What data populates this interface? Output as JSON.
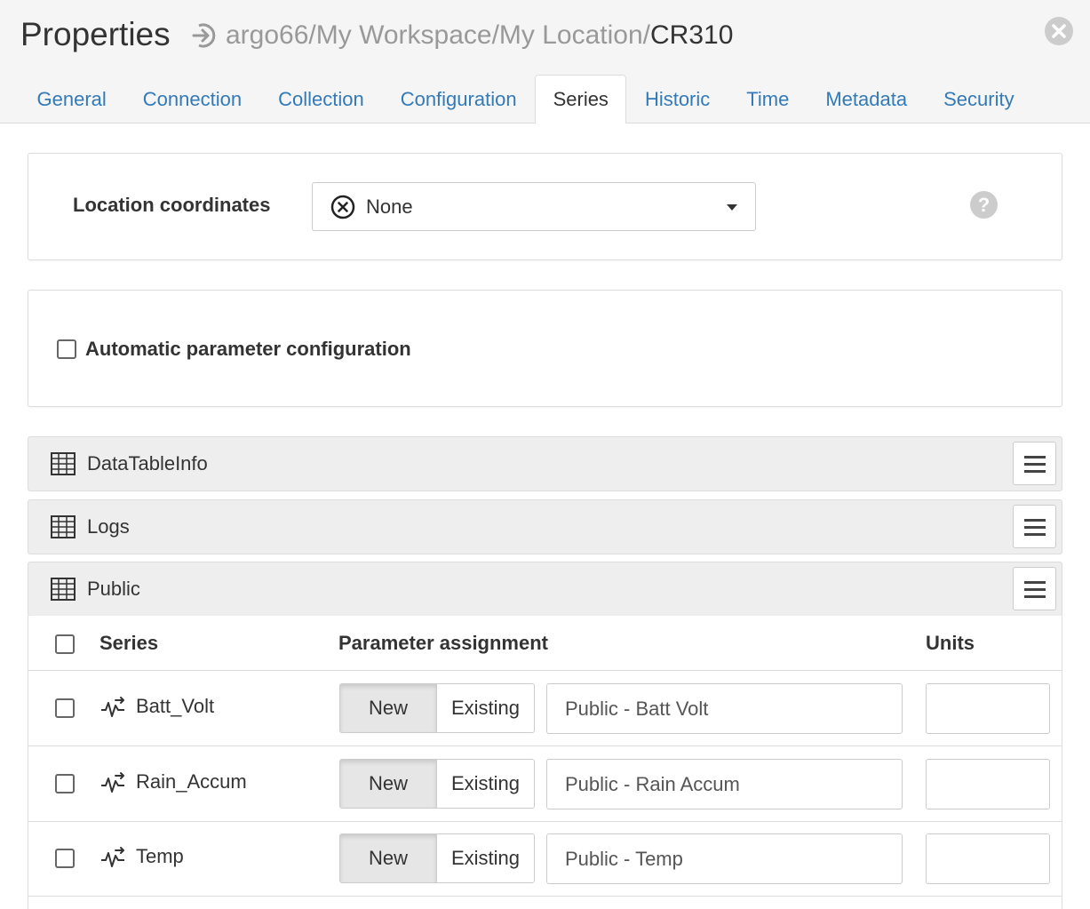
{
  "header": {
    "title": "Properties",
    "path_prefix": "argo66/My Workspace/My Location/",
    "path_current": "CR310"
  },
  "tabs": [
    {
      "label": "General"
    },
    {
      "label": "Connection"
    },
    {
      "label": "Collection"
    },
    {
      "label": "Configuration"
    },
    {
      "label": "Series",
      "active": true
    },
    {
      "label": "Historic"
    },
    {
      "label": "Time"
    },
    {
      "label": "Metadata"
    },
    {
      "label": "Security"
    }
  ],
  "location": {
    "label": "Location coordinates",
    "selected": "None"
  },
  "auto_config": {
    "label": "Automatic parameter configuration",
    "checked": false
  },
  "groups": [
    {
      "name": "DataTableInfo"
    },
    {
      "name": "Logs"
    },
    {
      "name": "Public"
    }
  ],
  "table": {
    "col_series": "Series",
    "col_param": "Parameter assignment",
    "col_units": "Units",
    "rows": [
      {
        "name": "Batt_Volt",
        "mode": "New",
        "param": "Public - Batt Volt",
        "units": ""
      },
      {
        "name": "Rain_Accum",
        "mode": "New",
        "param": "Public - Rain Accum",
        "units": ""
      },
      {
        "name": "Temp",
        "mode": "New",
        "param": "Public - Temp",
        "units": ""
      }
    ],
    "btn_new": "New",
    "btn_existing": "Existing"
  },
  "colors": {
    "link": "#337ab7",
    "header_bg": "#f5f5f5",
    "group_bg": "#eeeeee"
  }
}
